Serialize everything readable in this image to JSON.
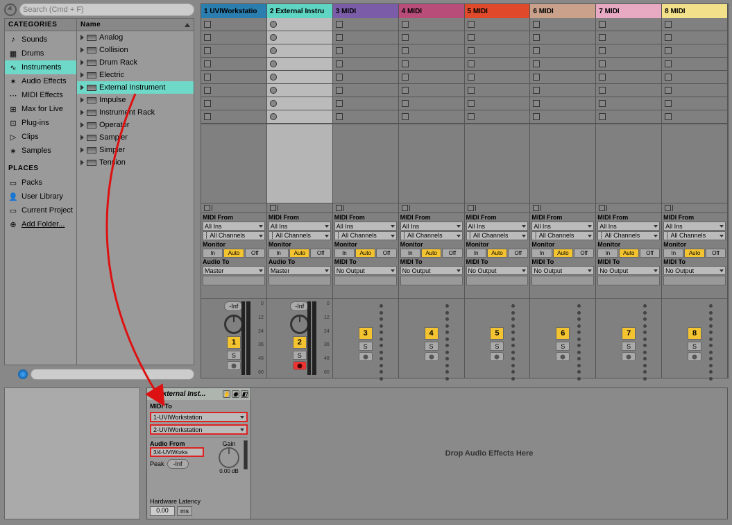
{
  "search": {
    "placeholder": "Search (Cmd + F)"
  },
  "categories": {
    "header": "CATEGORIES",
    "items": [
      {
        "label": "Sounds",
        "icon": "♪"
      },
      {
        "label": "Drums",
        "icon": "▦"
      },
      {
        "label": "Instruments",
        "icon": "∿",
        "selected": true
      },
      {
        "label": "Audio Effects",
        "icon": "✶"
      },
      {
        "label": "MIDI Effects",
        "icon": "⋯"
      },
      {
        "label": "Max for Live",
        "icon": "⊞"
      },
      {
        "label": "Plug-ins",
        "icon": "⊡"
      },
      {
        "label": "Clips",
        "icon": "▷"
      },
      {
        "label": "Samples",
        "icon": "∗"
      }
    ]
  },
  "places": {
    "header": "PLACES",
    "items": [
      {
        "label": "Packs",
        "icon": "▭"
      },
      {
        "label": "User Library",
        "icon": "👤"
      },
      {
        "label": "Current Project",
        "icon": "▭"
      },
      {
        "label": "Add Folder...",
        "icon": "⊕",
        "underline": true
      }
    ]
  },
  "namecol": {
    "header": "Name",
    "items": [
      {
        "label": "Analog"
      },
      {
        "label": "Collision"
      },
      {
        "label": "Drum Rack"
      },
      {
        "label": "Electric"
      },
      {
        "label": "External Instrument",
        "selected": true
      },
      {
        "label": "Impulse"
      },
      {
        "label": "Instrument Rack"
      },
      {
        "label": "Operator"
      },
      {
        "label": "Sampler"
      },
      {
        "label": "Simpler"
      },
      {
        "label": "Tension"
      }
    ]
  },
  "tracks": [
    {
      "n": 1,
      "label": "1 UVIWorkstatio",
      "color": "#2a7eb0",
      "type": "audio",
      "audioTo": "Master",
      "inf": "-Inf"
    },
    {
      "n": 2,
      "label": "2 External Instru",
      "color": "#5fd6c3",
      "type": "audio",
      "audioTo": "Master",
      "inf": "-Inf",
      "selected": true,
      "armed": true
    },
    {
      "n": 3,
      "label": "3 MIDI",
      "color": "#7a5ca8",
      "type": "midi",
      "midiTo": "No Output"
    },
    {
      "n": 4,
      "label": "4 MIDI",
      "color": "#b84d7a",
      "type": "midi",
      "midiTo": "No Output"
    },
    {
      "n": 5,
      "label": "5 MIDI",
      "color": "#e04a2a",
      "type": "midi",
      "midiTo": "No Output"
    },
    {
      "n": 6,
      "label": "6 MIDI",
      "color": "#caa28c",
      "type": "midi",
      "midiTo": "No Output"
    },
    {
      "n": 7,
      "label": "7 MIDI",
      "color": "#e8a9c2",
      "type": "midi",
      "midiTo": "No Output"
    },
    {
      "n": 8,
      "label": "8 MIDI",
      "color": "#f2e08a",
      "type": "midi",
      "midiTo": "No Output"
    }
  ],
  "io": {
    "midiFromLabel": "MIDI From",
    "allIns": "All Ins",
    "allCh": "All Channels",
    "monitorLabel": "Monitor",
    "monIn": "In",
    "monAuto": "Auto",
    "monOff": "Off",
    "audioToLabel": "Audio To",
    "midiToLabel": "MIDI To"
  },
  "meterTicks": [
    "0",
    "12",
    "24",
    "36",
    "48",
    "60"
  ],
  "solo": "S",
  "device": {
    "title": "External Inst...",
    "midiToLabel": "MIDI To",
    "midiTo1": "1-UVIWorkstation",
    "midiTo2": "2-UVIWorkstation",
    "audioFromLabel": "Audio From",
    "audioFrom": "3/4-UVIWorks",
    "gainLabel": "Gain",
    "gainVal": "0.00 dB",
    "peakLabel": "Peak",
    "peakVal": "-Inf",
    "latLabel": "Hardware Latency",
    "latVal": "0.00",
    "latUnit": "ms"
  },
  "dropzone": "Drop Audio Effects Here"
}
